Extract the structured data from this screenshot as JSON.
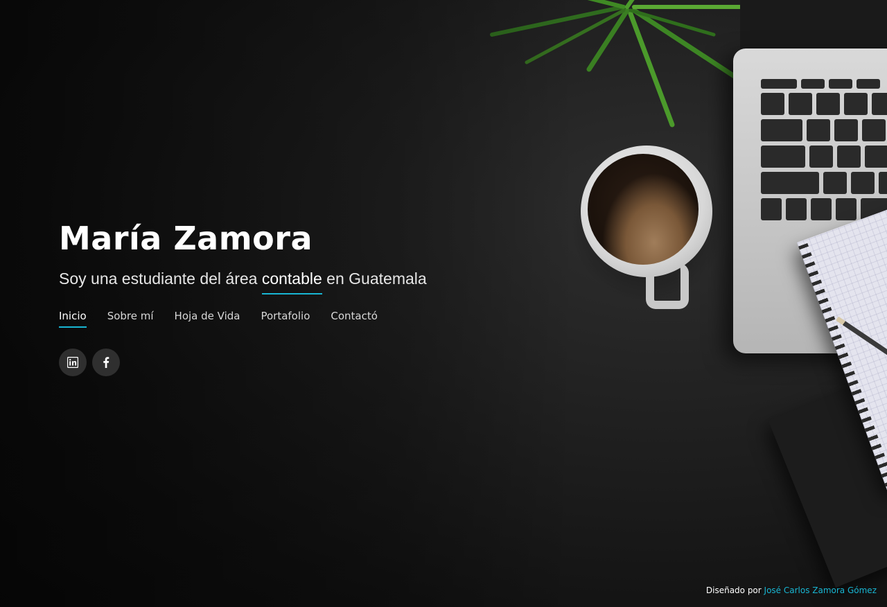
{
  "hero": {
    "name": "María Zamora",
    "tagline_prefix": "Soy una estudiante del área ",
    "tagline_highlight": "contable",
    "tagline_suffix": " en Guatemala"
  },
  "nav": {
    "items": [
      {
        "label": "Inicio",
        "active": true
      },
      {
        "label": "Sobre mí",
        "active": false
      },
      {
        "label": "Hoja de Vida",
        "active": false
      },
      {
        "label": "Portafolio",
        "active": false
      },
      {
        "label": "Contactó",
        "active": false
      }
    ]
  },
  "social": {
    "items": [
      {
        "icon": "linkedin-icon"
      },
      {
        "icon": "facebook-icon"
      }
    ]
  },
  "footer": {
    "credits_prefix": "Diseñado por ",
    "credits_author": "José Carlos Zamora Gómez"
  },
  "colors": {
    "accent": "#18b6d3",
    "background": "#141414",
    "text": "#ffffff"
  }
}
